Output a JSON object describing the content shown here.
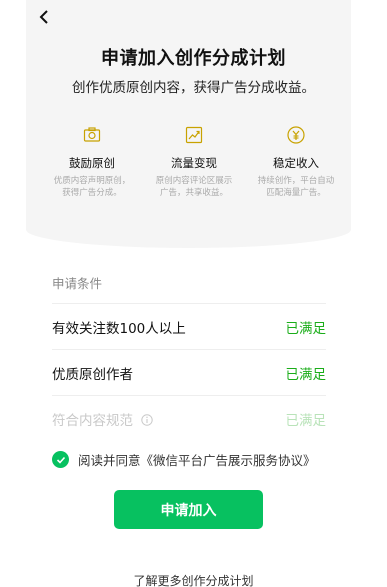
{
  "header": {
    "back_icon": "chevron-left-icon",
    "title": "申请加入创作分成计划",
    "subtitle": "创作优质原创内容，获得广告分成收益。"
  },
  "features": [
    {
      "icon": "camera-icon",
      "title": "鼓励原创",
      "desc_line1": "优质内容声明原创，",
      "desc_line2": "获得广告分成。"
    },
    {
      "icon": "trend-chart-icon",
      "title": "流量变现",
      "desc_line1": "原创内容评论区展示",
      "desc_line2": "广告，共享收益。"
    },
    {
      "icon": "yen-icon",
      "title": "稳定收入",
      "desc_line1": "持续创作，平台自动",
      "desc_line2": "匹配海量广告。"
    }
  ],
  "conditions": {
    "header": "申请条件",
    "rows": [
      {
        "label": "有效关注数100人以上",
        "status": "已满足"
      },
      {
        "label": "优质原创作者",
        "status": "已满足"
      },
      {
        "label": "符合内容规范",
        "status": "已满足"
      }
    ]
  },
  "agreement": {
    "text": "阅读并同意《微信平台广告展示服务协议》",
    "checked": true
  },
  "apply_button": "申请加入",
  "more_link": "了解更多创作分成计划",
  "colors": {
    "accent": "#07c160",
    "status_green": "#1aad19",
    "hero_bg": "#f5f5f5"
  }
}
